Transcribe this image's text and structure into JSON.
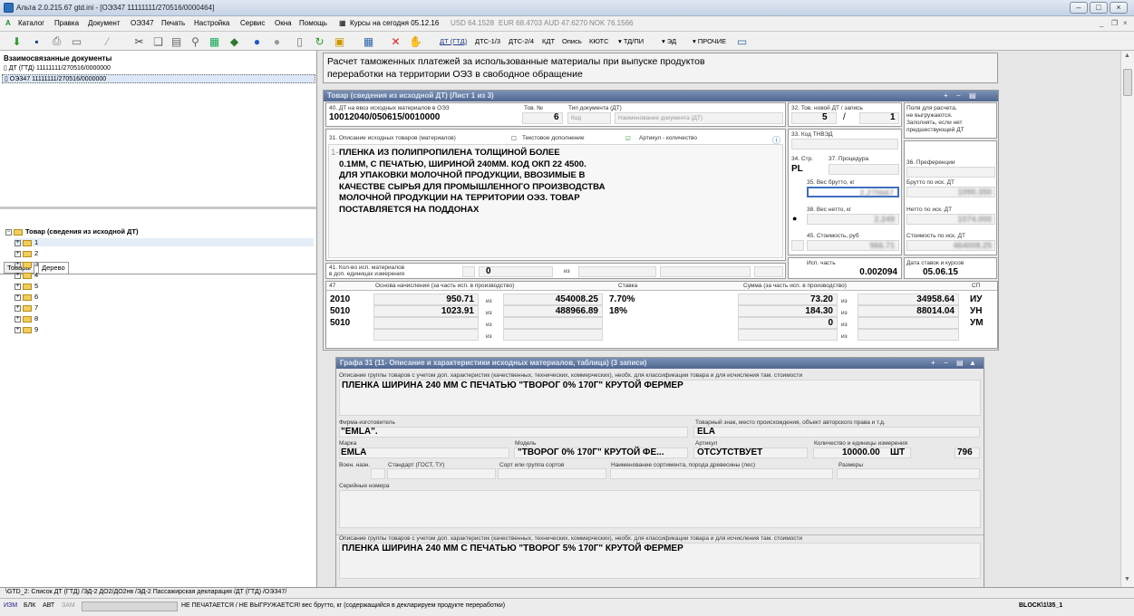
{
  "window": {
    "title": "Альта 2.0.215.67 gtd.ini - [ОЭЗ47 11111111/270516/0000464]"
  },
  "menu": {
    "items": [
      "Каталог",
      "Правка",
      "Документ",
      "ОЭЗ47",
      "Печать",
      "Настройка",
      "Сервис",
      "Окна",
      "Помощь"
    ],
    "rates_label": "Курсы на сегодня 05.12.16",
    "rates": [
      "USD 64.1528",
      "EUR 68.4703",
      "AUD 47.6270",
      "NOK 76.1566"
    ]
  },
  "toolbar": {
    "doc_buttons": [
      "ДТ (ГТД)",
      "ДТС-1/3",
      "ДТС-2/4",
      "КДТ",
      "Опись",
      "КЮТС"
    ],
    "drop_buttons": [
      "▾ ТД/ПИ",
      "▾ ЭД",
      "▾ ПРОЧИЕ"
    ]
  },
  "left": {
    "header": "Взаимосвязанные документы",
    "docs": [
      "ДТ (ГТД) 11111111/270516/0000000",
      "ОЭЗ47 11111111/270516/0000000"
    ],
    "tabs": [
      "Товары",
      "Дерево"
    ],
    "tree_root": "Товар (сведения из исходной ДТ)",
    "tree_items": [
      "1",
      "2",
      "3",
      "4",
      "5",
      "6",
      "7",
      "8",
      "9"
    ]
  },
  "heading": "Расчет таможенных платежей за использованные материалы при выпуске продуктов\nпереработки на территории ОЭЗ в свободное обращение",
  "goods": {
    "title": "Товар (сведения из исходной ДТ) (Лист 1 из 3)",
    "f40_label": "40. ДТ на ввоз исходных материалов в ОЭЗ",
    "f40_value": "10012040/050615/0010000",
    "tov_no_label": "Тов. №",
    "tov_no_value": "6",
    "doc_type_label": "Тип документа (ДТ)",
    "doc_type_code": "Код",
    "doc_type_name": "Наименование документа (ДТ)",
    "f32_label": "32. Тов. новой ДТ / запись",
    "f32_a": "5",
    "f32_sep": "/",
    "f32_b": "1",
    "note": "Поля для расчета,\nне выгружаются.\nЗаполнять, если нет\nпредшествующей ДТ",
    "f31_label": "31. Описание исходных товаров (материалов)",
    "text_add": "Текстовое дополнение",
    "article_qty": "Артикул - количество",
    "desc_num": "1-",
    "description": "ПЛЕНКА ИЗ ПОЛИПРОПИЛЕНА ТОЛЩИНОЙ БОЛЕЕ\n0.1ММ, С ПЕЧАТЬЮ, ШИРИНОЙ 240ММ. КОД ОКП 22 4500.\nДЛЯ УПАКОВКИ МОЛОЧНОЙ ПРОДУКЦИИ, ВВОЗИМЫЕ В\nКАЧЕСТВЕ СЫРЬЯ ДЛЯ ПРОМЫШЛЕННОГО ПРОИЗВОДСТВА\nМОЛОЧНОЙ ПРОДУКЦИИ НА ТЕРРИТОРИИ ОЭЗ. ТОВАР\nПОСТАВЛЯЕТСЯ НА ПОДДОНАХ",
    "f33_label": "33. Код ТНВЭД",
    "f34_label": "34. Стр.",
    "f34_value": "PL",
    "f37_label": "37. Процедура",
    "f36_label": "36. Преференции",
    "f35_label": "35. Вес брутто, кг",
    "f35_value": "2.270667",
    "gross_iskdt_label": "Брутто по иск. ДТ",
    "gross_iskdt_value": "1090.350",
    "f38_label": "38. Вес нетто, кг",
    "f38_value": "2.249",
    "net_iskdt_label": "Нетто по иск. ДТ",
    "net_iskdt_value": "1074.000",
    "f45_label": "45. Стоимость, руб",
    "f45_value": "966.71",
    "cost_iskdt_label": "Стоимость по иск. ДТ",
    "cost_iskdt_value": "464008.25",
    "isp_part_label": "Исп. часть",
    "isp_part_value": "0.002094",
    "date_label": "Дата ставок и курсов",
    "date_value": "05.06.15",
    "f41_label": "41. Кол-во исп. материалов\nв доп. единицах измерения",
    "f41_value": "0",
    "iz": "из",
    "t47": {
      "label": "47",
      "h_base": "Основа начисления (за часть исп. в производство)",
      "h_rate": "Ставка",
      "h_sum": "Сумма (за часть исп. в производство)",
      "h_sp": "СП",
      "rows": [
        {
          "code": "2010",
          "base": "950.71",
          "iz": "из",
          "base_total": "454008.25",
          "rate": "7.70%",
          "sum": "73.20",
          "iz2": "из",
          "sum_total": "34958.64",
          "sp": "ИУ"
        },
        {
          "code": "5010",
          "base": "1023.91",
          "iz": "из",
          "base_total": "488966.89",
          "rate": "18%",
          "sum": "184.30",
          "iz2": "из",
          "sum_total": "88014.04",
          "sp": "УН"
        },
        {
          "code": "5010",
          "base": "",
          "iz": "из",
          "base_total": "",
          "rate": "",
          "sum": "0",
          "iz2": "из",
          "sum_total": "",
          "sp": "УМ"
        },
        {
          "code": "",
          "base": "",
          "iz": "из",
          "base_total": "",
          "rate": "",
          "sum": "",
          "iz2": "из",
          "sum_total": "",
          "sp": ""
        }
      ]
    }
  },
  "g31": {
    "title": "Графа 31 (11- Описание и характеристики исходных материалов, таблица) (3 записи)",
    "desc_label": "Описание группы товаров с учетом доп. характеристик (качественных, технических, коммерческих), необх. для классификации товара и для исчисления там. стоимости",
    "desc1": "ПЛЕНКА ШИРИНА 240 ММ С ПЕЧАТЬЮ \"ТВОРОГ 0% 170Г\" КРУТОЙ ФЕРМЕР",
    "maker_label": "Фирма-изготовитель",
    "maker_value": "\"EMLA\".",
    "tm_label": "Товарный знак, место происхождения, объект авторского права и т.д.",
    "tm_value": "ELA",
    "brand_label": "Марка",
    "brand_value": "EMLA",
    "model_label": "Модель",
    "model_value": "\"ТВОРОГ 0% 170Г\" КРУТОЙ ФЕ...",
    "article_label": "Артикул",
    "article_value": "ОТСУТСТВУЕТ",
    "qty_label": "Количество и единицы измерения",
    "qty_value": "10000.00",
    "unit": "ШТ",
    "unit_code": "796",
    "mil_label": "Воен. назн.",
    "std_label": "Стандарт (ГОСТ, ТУ)",
    "sort_label": "Сорт или группа сортов",
    "assort_label": "Наименование сортимента, порода древесины (лес)",
    "size_label": "Размеры",
    "serial_label": "Серийные номера",
    "desc2": "ПЛЕНКА ШИРИНА 240 ММ С ПЕЧАТЬЮ \"ТВОРОГ 5% 170Г\" КРУТОЙ ФЕРМЕР"
  },
  "bottom_tabs": "\\GTD_2: Список ДТ (ГТД) /ЭД-2 ДО2/ДО2нв /ЭД-2 Пассажирская декларация /ДТ (ГТД) /ОЭЗ47/",
  "status": {
    "modes": [
      "ИЗМ",
      "БЛК",
      "АВТ",
      "ЗАМ"
    ],
    "message": "НЕ ПЕЧАТАЕТСЯ / НЕ ВЫГРУЖАЕТСЯ! вес брутто, кг (содержащийся в декларируем продукте переработки)",
    "block": "BLOCK\\1\\35_1"
  },
  "colors": {
    "section_bar": "#5a7199",
    "folder": "#f1cd5b",
    "window_bg": "#e6e6e6"
  }
}
